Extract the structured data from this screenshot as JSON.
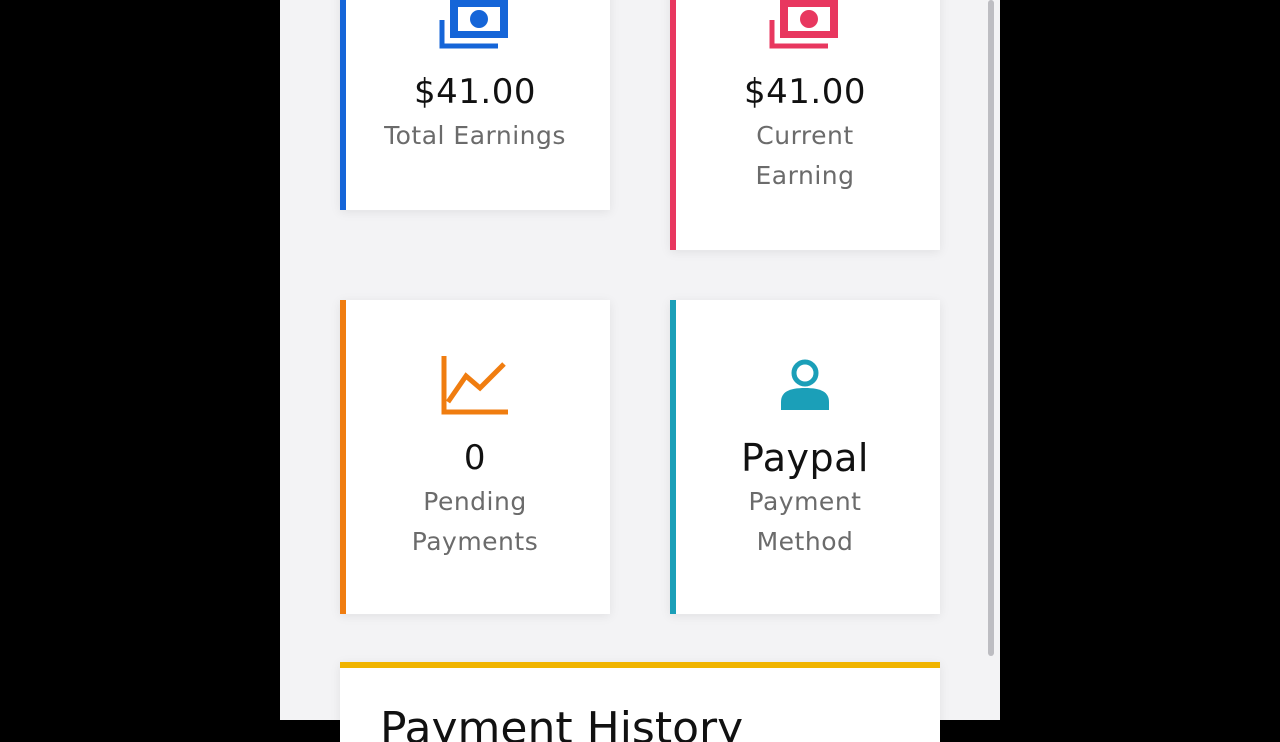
{
  "stats": {
    "total_earnings": {
      "value": "$41.00",
      "label": "Total Earnings",
      "color": "#1565d8",
      "icon": "cash-icon"
    },
    "current_earning": {
      "value": "$41.00",
      "label": "Current Earning",
      "color": "#e8375f",
      "icon": "cash-icon"
    },
    "pending_payments": {
      "value": "0",
      "label": "Pending Payments",
      "color": "#f07d10",
      "icon": "line-chart-icon"
    },
    "payment_method": {
      "value": "Paypal",
      "label": "Payment Method",
      "color": "#1b9fb8",
      "icon": "user-icon"
    }
  },
  "history": {
    "title": "Payment History",
    "accent_color": "#f0b400"
  }
}
